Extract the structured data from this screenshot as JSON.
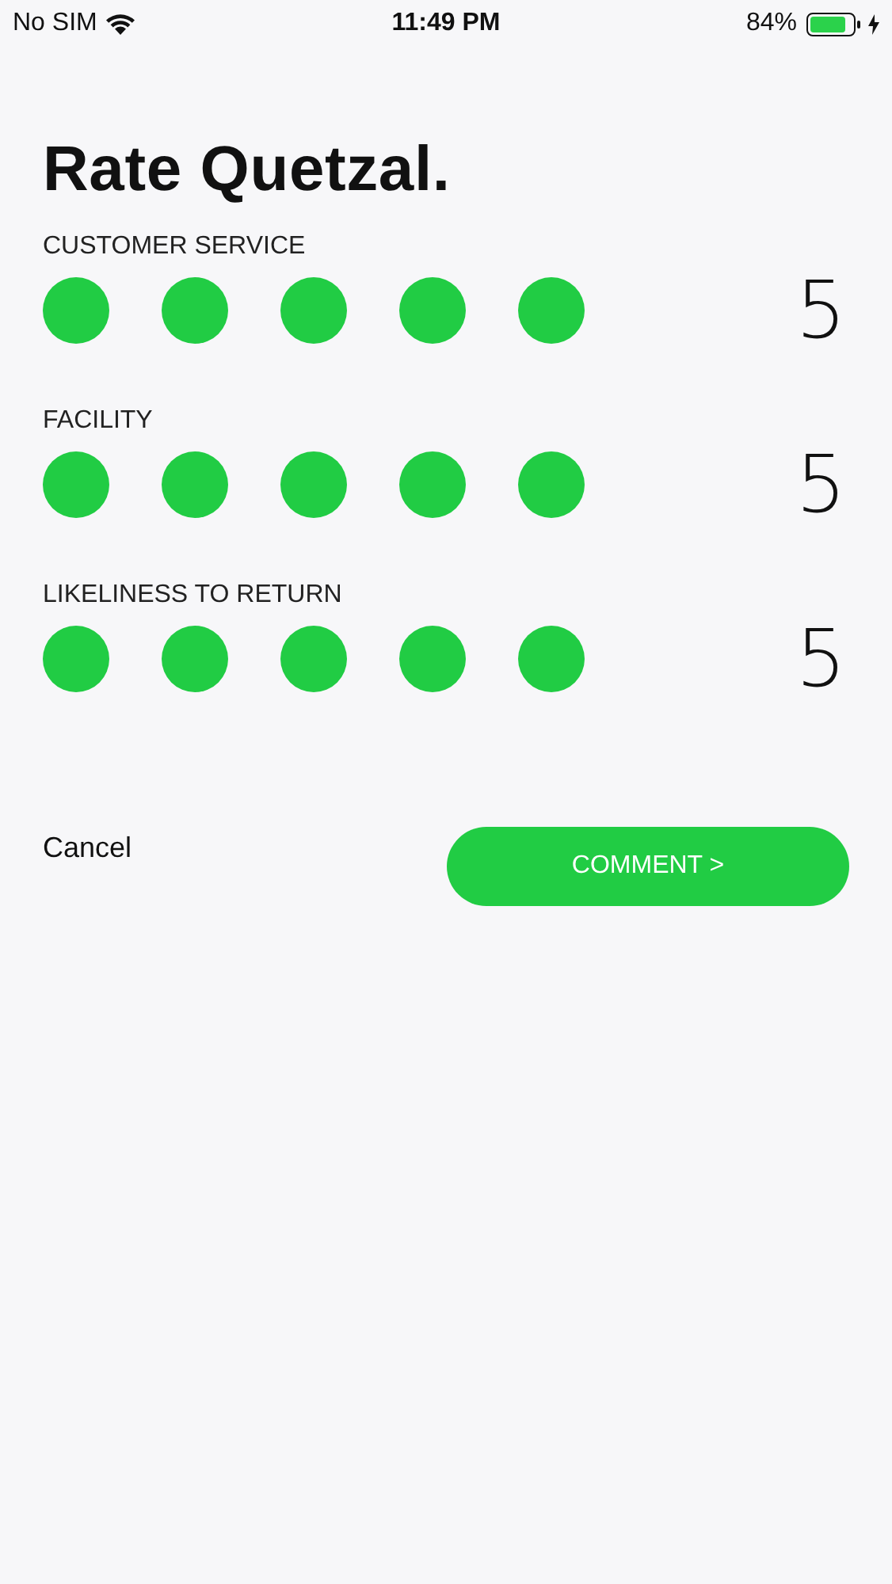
{
  "status_bar": {
    "carrier": "No SIM",
    "time": "11:49 PM",
    "battery": "84%"
  },
  "title": "Rate Quetzal.",
  "ratings": [
    {
      "label": "CUSTOMER SERVICE",
      "stars": 5,
      "score": "5"
    },
    {
      "label": "FACILITY",
      "stars": 5,
      "score": "5"
    },
    {
      "label": "LIKELINESS TO RETURN",
      "stars": 5,
      "score": "5"
    }
  ],
  "cancel": "Cancel",
  "comment_button": "COMMENT >"
}
